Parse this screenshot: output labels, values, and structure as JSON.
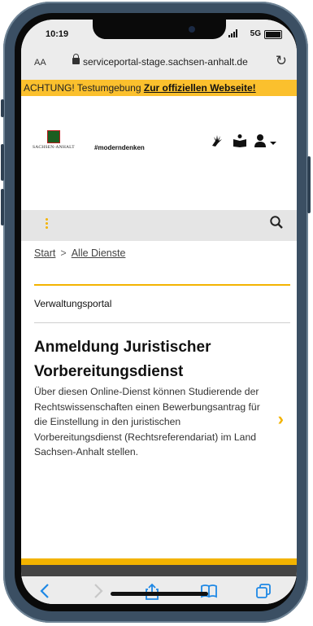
{
  "status": {
    "time": "10:19",
    "network": "5G"
  },
  "browser": {
    "text_size": "AA",
    "url": "serviceportal-stage.sachsen-anhalt.de",
    "reload_glyph": "↻"
  },
  "banner": {
    "text": "ACHTUNG! Testumgebung",
    "link": "Zur offiziellen Webseite!"
  },
  "header": {
    "logo_text": "SACHSEN-ANHALT",
    "hashtag": "#moderndenken",
    "icons": [
      "sign-language-icon",
      "easy-read-icon",
      "user-icon",
      "chevron-down-icon"
    ]
  },
  "breadcrumb": {
    "home": "Start",
    "separator": ">",
    "current": "Alle Dienste"
  },
  "section": {
    "label": "Verwaltungsportal"
  },
  "service": {
    "title": "Anmeldung Juristischer Vorbereitungsdienst",
    "description": "Über diesen Online-Dienst können Studierende der Rechtswissenschaften einen Bewerbungsantrag für die Einstellung in den juristischen Vorbereitungsdienst (Rechtsreferendariat) im Land Sachsen-Anhalt stellen."
  },
  "colors": {
    "accent": "#f3b300",
    "banner": "#fbc02d",
    "link_blue": "#1e88e5"
  }
}
